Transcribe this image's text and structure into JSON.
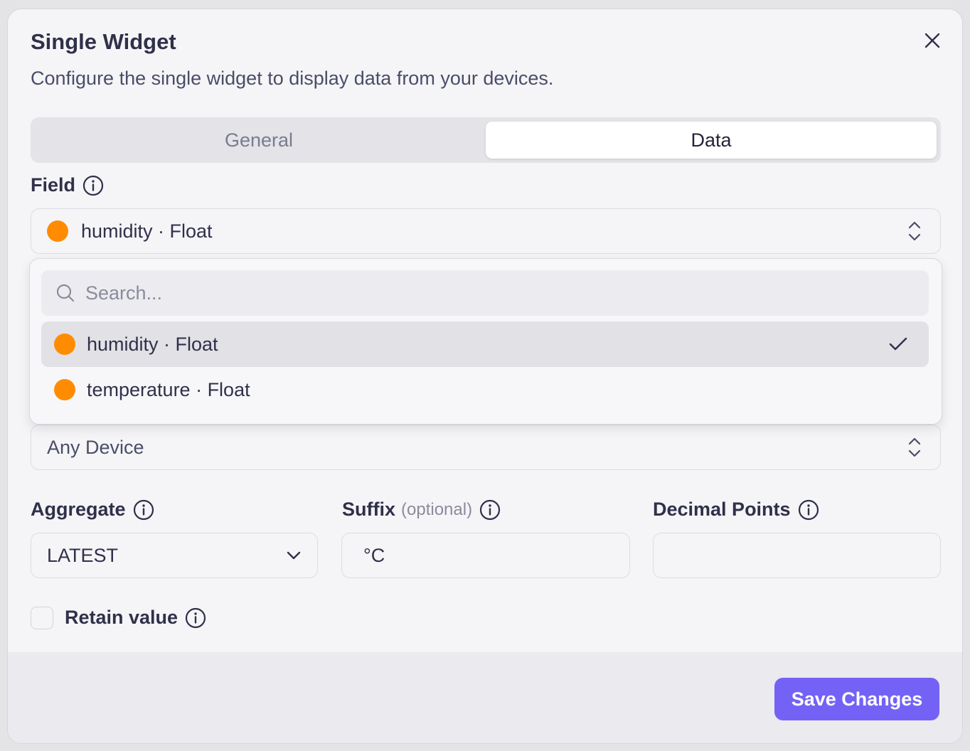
{
  "dialog": {
    "title": "Single Widget",
    "subtitle": "Configure the single widget to display data from your devices."
  },
  "tabs": [
    {
      "label": "General",
      "active": false
    },
    {
      "label": "Data",
      "active": true
    }
  ],
  "field": {
    "label": "Field",
    "selected": "humidity · Float",
    "search_placeholder": "Search...",
    "options": [
      {
        "label": "humidity · Float",
        "selected": true
      },
      {
        "label": "temperature · Float",
        "selected": false
      }
    ]
  },
  "device": {
    "selected": "Any Device"
  },
  "aggregate": {
    "label": "Aggregate",
    "value": "LATEST"
  },
  "suffix": {
    "label": "Suffix",
    "optional": "(optional)",
    "value": "°C"
  },
  "decimal_points": {
    "label": "Decimal Points",
    "value": ""
  },
  "retain": {
    "label": "Retain value",
    "checked": false
  },
  "footer": {
    "save_label": "Save Changes"
  },
  "colors": {
    "accent": "#7462f6",
    "dot": "#ff8c00"
  }
}
